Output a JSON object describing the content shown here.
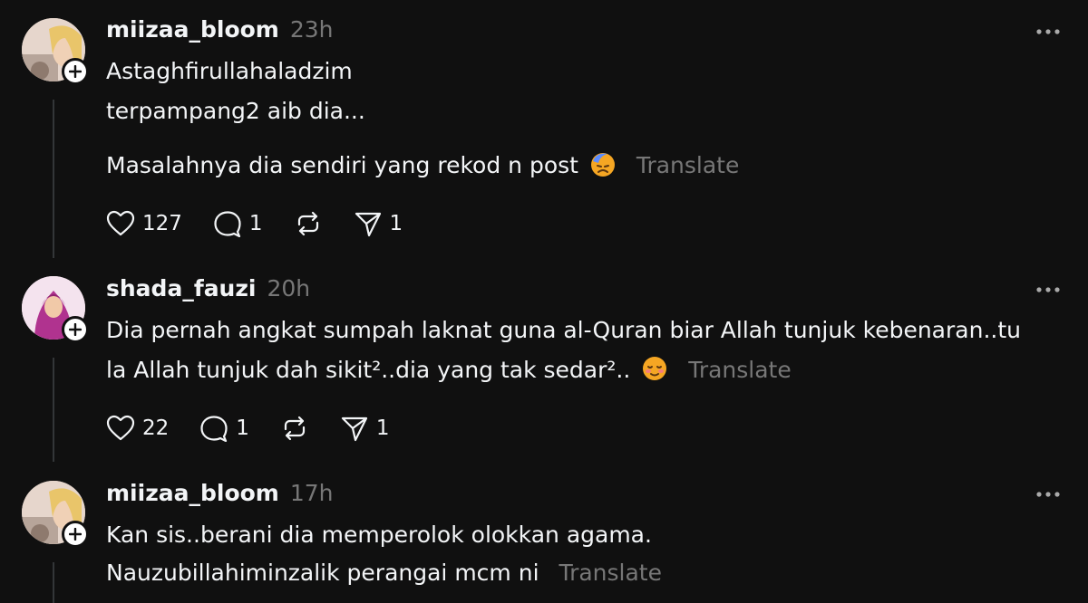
{
  "posts": [
    {
      "username": "miizaa_bloom",
      "time": "23h",
      "lines": [
        "Astaghfirullahaladzim",
        "terpampang2 aib dia...",
        "Masalahnya dia sendiri yang rekod n post"
      ],
      "translate": "Translate",
      "likes": "127",
      "replies": "1",
      "shares": "1"
    },
    {
      "username": "shada_fauzi",
      "time": "20h",
      "lines": [
        "Dia pernah angkat sumpah laknat guna al-Quran biar Allah tunjuk kebenaran..tu",
        "la Allah tunjuk dah sikit²..dia yang tak sedar².."
      ],
      "translate": "Translate",
      "likes": "22",
      "replies": "1",
      "shares": "1"
    },
    {
      "username": "miizaa_bloom",
      "time": "17h",
      "lines": [
        "Kan sis..berani dia memperolok olokkan agama.",
        "Nauzubillahiminzalik perangai mcm ni"
      ],
      "translate": "Translate"
    }
  ],
  "colors": {
    "background": "#101010",
    "text": "#f3f5f7",
    "muted": "#777777",
    "thread_line": "#333638"
  }
}
